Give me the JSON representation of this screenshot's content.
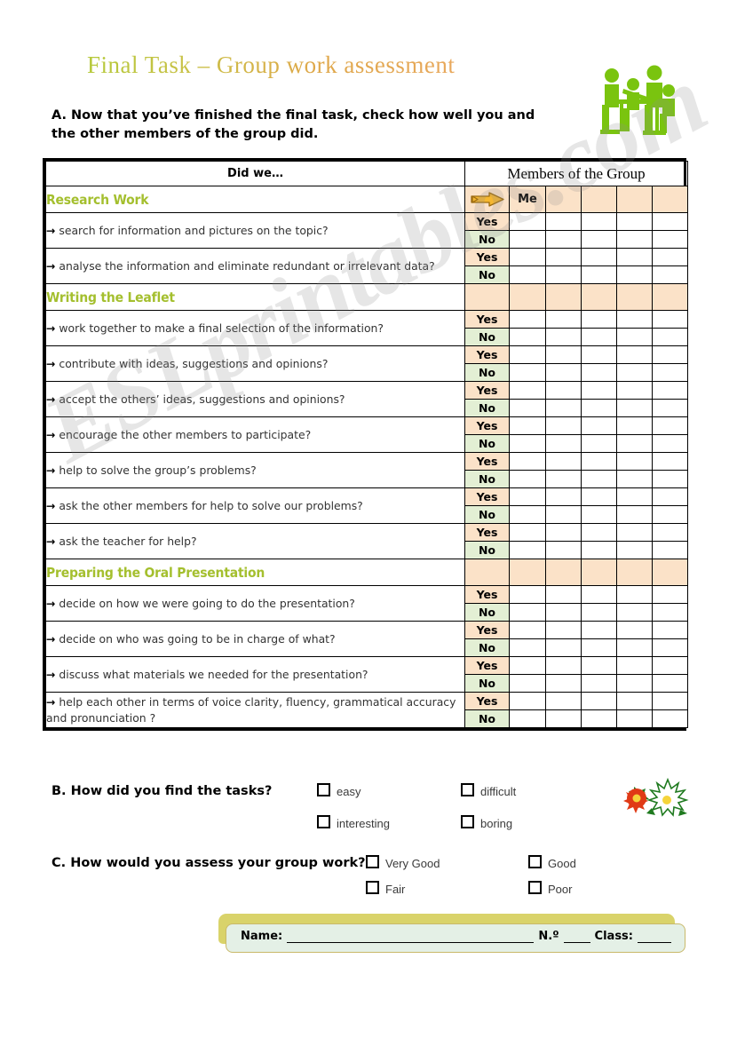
{
  "title": "Final Task – Group work assessment",
  "intro": "A. Now that you’ve finished the final task, check how well you and the other members of the group did.",
  "watermark": "ESLprintables.com",
  "colors": {
    "section_heading": "#a4bf2e",
    "yes_cell": "#fbe2c8",
    "no_cell": "#e3efd4",
    "title_gradient_start": "#b5c93a",
    "title_gradient_end": "#e8a85c",
    "arrow_icon": "#f0a81e",
    "namebar_fill": "#e4f0e6",
    "namebar_shadow": "#d9d36a"
  },
  "table": {
    "did_we_header": "Did we…",
    "members_header": "Members of the Group",
    "me_label": "Me",
    "yes_label": "Yes",
    "no_label": "No",
    "member_column_count": 5,
    "sections": [
      {
        "heading": "Research Work",
        "questions": [
          "search for information and pictures on the topic?",
          "analyse the information and eliminate redundant or irrelevant data?"
        ]
      },
      {
        "heading": "Writing the Leaflet",
        "questions": [
          "work together to make a final selection of the information?",
          "contribute with ideas, suggestions and opinions?",
          "accept the others’ ideas, suggestions and opinions?",
          "encourage the other members to participate?",
          "help to solve the group’s problems?",
          "ask the other members for help to solve our problems?",
          "ask the teacher for help?"
        ]
      },
      {
        "heading": "Preparing the Oral Presentation",
        "questions": [
          "decide on how we were going to do the presentation?",
          "decide on who was going to be in charge of what?",
          "discuss what materials we needed for the presentation?",
          "help each other in terms of voice clarity, fluency, grammatical accuracy and pronunciation ?"
        ]
      }
    ]
  },
  "section_b": {
    "label": "B. How did you find the tasks?",
    "options": [
      "easy",
      "difficult",
      "interesting",
      "boring"
    ]
  },
  "section_c": {
    "label": "C. How would you assess your group work?",
    "options": [
      "Very Good",
      "Good",
      "Fair",
      "Poor"
    ]
  },
  "namebar": {
    "name_label": "Name:",
    "number_label": "N.º",
    "class_label": "Class:"
  }
}
